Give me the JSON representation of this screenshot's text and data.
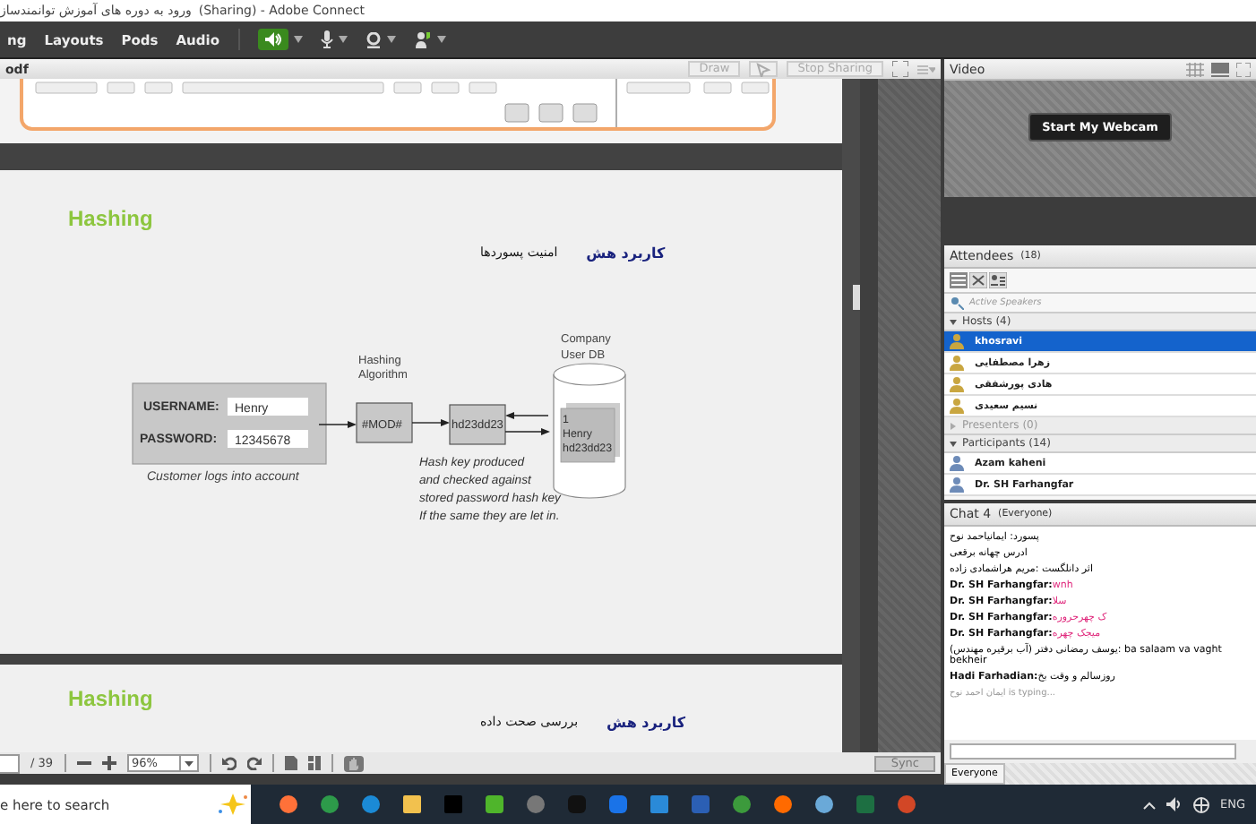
{
  "window": {
    "title_persian": "ورود به دوره های آموزش توانمندساز",
    "title_suffix": "(Sharing) - Adobe Connect"
  },
  "menu": {
    "items": [
      "ng",
      "Layouts",
      "Pods",
      "Audio"
    ],
    "speaker_on": true
  },
  "share_pod": {
    "title": "odf",
    "buttons": [
      "Draw",
      "Stop Sharing"
    ]
  },
  "slides": [
    {
      "kind": "keyboard"
    },
    {
      "kind": "diagram",
      "heading": "Hashing",
      "rtl_title": "کاربرد هش",
      "rtl_subtitle": "امنیت پسوردها",
      "diagram": {
        "username_label": "USERNAME:",
        "username": "Henry",
        "password_label": "PASSWORD:",
        "password": "12345678",
        "login_caption": "Customer logs into account",
        "algo_label": [
          "Hashing",
          "Algorithm"
        ],
        "algo": "#MOD#",
        "hash": "hd23dd23",
        "db_label": [
          "Company",
          "User DB"
        ],
        "record": [
          "1",
          "Henry",
          "hd23dd23"
        ],
        "note": [
          "Hash key produced",
          "and checked against",
          "stored password hash key",
          "If the same they are let in."
        ]
      }
    },
    {
      "kind": "title",
      "heading": "Hashing",
      "rtl_title": "کاربرد هش",
      "rtl_subtitle": "بررسی صحت داده"
    }
  ],
  "toolbar": {
    "page_total": "/ 39",
    "zoom": "96%",
    "sync": "Sync"
  },
  "video": {
    "title": "Video",
    "button": "Start My Webcam"
  },
  "attendees": {
    "title": "Attendees",
    "count": "(18)",
    "active_speakers": "Active Speakers",
    "groups": [
      {
        "label": "Hosts (4)",
        "expanded": true,
        "people": [
          {
            "name": "khosravi",
            "selected": true
          },
          {
            "name": "زهرا مصطفایی",
            "selected": false
          },
          {
            "name": "هادی پورشفقی",
            "selected": false
          },
          {
            "name": "نسیم سعیدی",
            "selected": false
          }
        ]
      },
      {
        "label": "Presenters (0)",
        "expanded": false
      },
      {
        "label": "Participants (14)",
        "expanded": true,
        "people": [
          {
            "name": "Azam kaheni",
            "selected": false
          },
          {
            "name": "Dr. SH Farhangfar",
            "selected": false
          }
        ]
      }
    ]
  },
  "chat": {
    "title": "Chat 4",
    "scope": "(Everyone)",
    "messages": [
      {
        "text": "پسورد: ایمانیاحمد نوح",
        "color": "#000000"
      },
      {
        "text": "ادرس چهانه برقعی",
        "color": "#000000"
      },
      {
        "text": "اثر دانلگست :مریم هراشمادی زاده",
        "color": "#000000"
      },
      {
        "sender": "Dr. SH Farhangfar:",
        "text": "wnh",
        "color": "#e0287c"
      },
      {
        "sender": "Dr. SH Farhangfar:",
        "text": "سلا",
        "color": "#e0287c"
      },
      {
        "sender": "Dr. SH Farhangfar:",
        "text": "ک چهرحروره",
        "color": "#e0287c"
      },
      {
        "sender": "Dr. SH Farhangfar:",
        "text": "میجک چهره",
        "color": "#e0287c"
      },
      {
        "text": "(آب برقیره مهندس) یوسف رمضانی دفتر: ba salaam va vaght bekheir",
        "color": "#000000"
      },
      {
        "sender": "Hadi Farhadian:",
        "text": "روزسالم و وقت بخ",
        "color": "#000000"
      }
    ],
    "typing": "ایمان احمد نوح is typing...",
    "tab": "Everyone"
  },
  "taskbar": {
    "search_placeholder": "e here to search",
    "language": "ENG"
  }
}
